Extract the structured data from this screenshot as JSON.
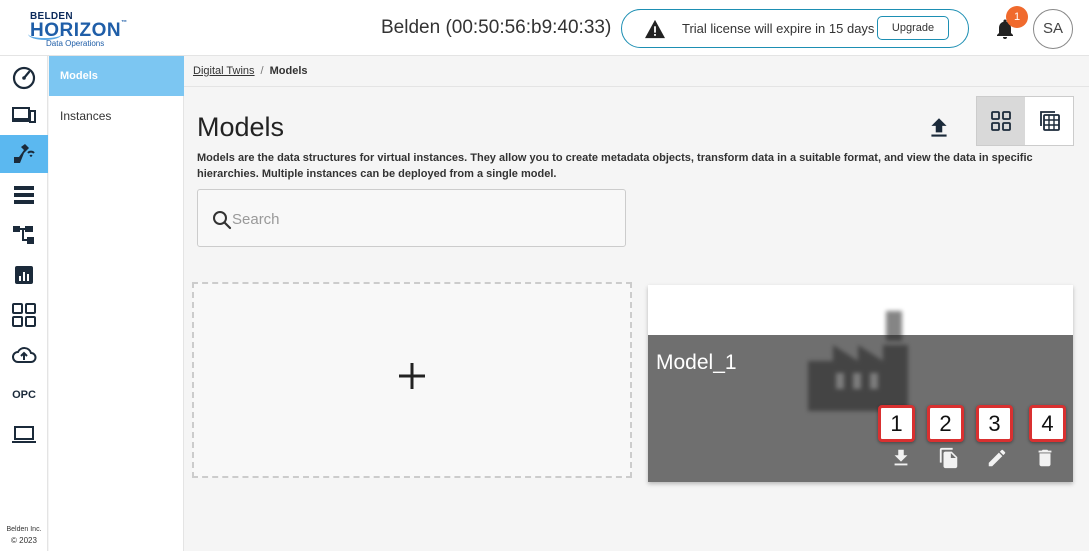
{
  "brand": {
    "line1": "BELDEN",
    "line2": "HORIZON",
    "tm": "™",
    "line3": "Data Operations"
  },
  "header": {
    "device_title": "Belden (00:50:56:b9:40:33)",
    "license_text": "Trial license will expire in 15 days",
    "upgrade_label": "Upgrade",
    "notification_count": "1",
    "avatar_initials": "SA"
  },
  "rail": {
    "items": [
      "dashboard-icon",
      "devices-icon",
      "digital-twins-icon",
      "storage-icon",
      "hierarchy-icon",
      "analytics-icon",
      "apps-icon",
      "cloud-upload-icon",
      "opc-icon",
      "laptop-icon"
    ],
    "opc_label": "OPC",
    "footer_company": "Belden Inc.",
    "footer_year": "© 2023"
  },
  "subnav": {
    "items": [
      {
        "label": "Models",
        "active": true
      },
      {
        "label": "Instances",
        "active": false
      }
    ]
  },
  "breadcrumb": {
    "root": "Digital Twins",
    "separator": "/",
    "current": "Models"
  },
  "main": {
    "title": "Models",
    "description": "Models are the data structures for virtual instances. They allow you to create metadata objects, transform data in a suitable format, and view the data in specific hierarchies. Multiple instances can be deployed from a single model.",
    "search_placeholder": "Search"
  },
  "models": [
    {
      "name": "Model_1",
      "actions": [
        "download-icon",
        "copy-icon",
        "edit-icon",
        "delete-icon"
      ]
    }
  ],
  "callouts": [
    "1",
    "2",
    "3",
    "4"
  ],
  "colors": {
    "accent": "#1d8fb3",
    "active_nav": "#5bb8f0",
    "badge": "#f06a2d",
    "callout_border": "#d93030",
    "card_dark": "#6f6f6f"
  }
}
